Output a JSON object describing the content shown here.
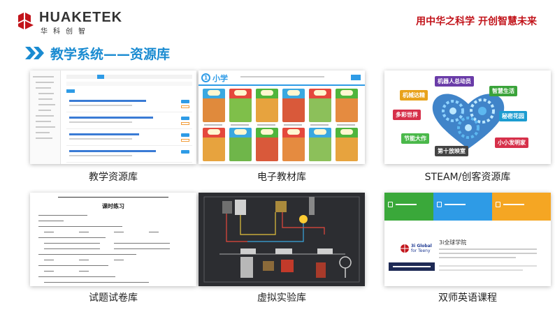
{
  "header": {
    "logo_text": "HUAKETEK",
    "logo_sub": "华科创智",
    "slogan": "用中华之科学  开创智慧未来"
  },
  "section_title": "教学系统——资源库",
  "cards": [
    {
      "caption": "教学资源库"
    },
    {
      "caption": "电子教材库",
      "badge_num": "1",
      "badge_label": "小学"
    },
    {
      "caption": "STEAM/创客资源库",
      "tags": [
        "机器人总动员",
        "智慧生活",
        "机械达精",
        "多彩世界",
        "秘密花园",
        "节能大作",
        "小小发明家",
        "第十放映室"
      ]
    },
    {
      "caption": "试题试卷库",
      "paper_title": "课时练习"
    },
    {
      "caption": "虚拟实验库"
    },
    {
      "caption": "双师英语课程",
      "school_name": "3i全球学院",
      "brand_top": "3i Global",
      "brand_bottom": "for Teeny"
    }
  ],
  "colors": {
    "brand_red": "#c2141b",
    "title_blue": "#1a8bd1"
  }
}
